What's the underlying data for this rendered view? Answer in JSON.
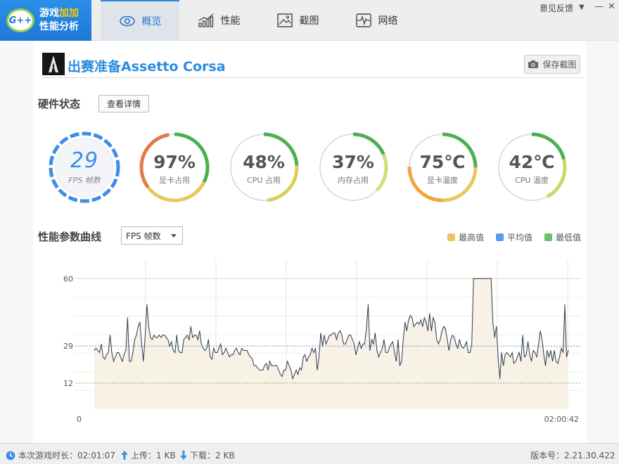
{
  "app": {
    "logo_mark": "G++",
    "logo_line1_a": "游戏",
    "logo_line1_b": "加加",
    "logo_line2": "性能分析"
  },
  "nav": {
    "tabs": [
      {
        "label": "概览",
        "icon": "eye-icon",
        "active": true
      },
      {
        "label": "性能",
        "icon": "bar-chart-icon",
        "active": false
      },
      {
        "label": "截图",
        "icon": "image-icon",
        "active": false
      },
      {
        "label": "网络",
        "icon": "pulse-icon",
        "active": false
      }
    ],
    "feedback": "意见反馈",
    "dropdown_glyph": "▼",
    "minimize_glyph": "—",
    "close_glyph": "✕"
  },
  "game": {
    "title": "出赛准备Assetto Corsa",
    "icon": "assassin-logo-icon",
    "save_label": "保存截图"
  },
  "hardware": {
    "title": "硬件状态",
    "detail_button": "查看详情",
    "fps": {
      "value": "29",
      "label": "FPS 帧数"
    },
    "gauges": [
      {
        "value": "97%",
        "label": "显卡占用",
        "fill": 0.97,
        "colors": [
          "#4caf50",
          "#e9c75a",
          "#e07a4a"
        ]
      },
      {
        "value": "48%",
        "label": "CPU 占用",
        "fill": 0.48,
        "colors": [
          "#4caf50",
          "#d8cf62"
        ]
      },
      {
        "value": "37%",
        "label": "内存占用",
        "fill": 0.37,
        "colors": [
          "#4caf50",
          "#cfe07a"
        ]
      },
      {
        "value": "75℃",
        "label": "显卡温度",
        "fill": 0.75,
        "colors": [
          "#4caf50",
          "#e9c75a",
          "#f0a63a"
        ]
      },
      {
        "value": "42℃",
        "label": "CPU 温度",
        "fill": 0.42,
        "colors": [
          "#4caf50",
          "#cfd66a"
        ]
      }
    ]
  },
  "curve": {
    "title": "性能参数曲线",
    "selector": "FPS 帧数",
    "legend": [
      {
        "label": "最高值",
        "color": "#e8c46a"
      },
      {
        "label": "平均值",
        "color": "#5b9be8"
      },
      {
        "label": "最低值",
        "color": "#6cbf6c"
      }
    ]
  },
  "chart_data": {
    "type": "line",
    "series": [
      {
        "name": "FPS 帧数",
        "values": [
          27,
          28,
          27,
          26,
          30,
          24,
          23,
          25,
          26,
          34,
          26,
          22,
          24,
          26,
          26,
          24,
          22,
          25,
          27,
          42,
          22,
          22,
          26,
          32,
          34,
          38,
          40,
          30,
          22,
          34,
          48,
          38,
          33,
          32,
          34,
          33,
          33,
          34,
          33,
          34,
          34,
          33,
          32,
          29,
          31,
          27,
          26,
          34,
          27,
          26,
          26,
          32,
          33,
          34,
          32,
          38,
          33,
          34,
          34,
          32,
          36,
          30,
          28,
          27,
          28,
          32,
          24,
          23,
          28,
          26,
          26,
          28,
          30,
          25,
          26,
          28,
          26,
          24,
          25,
          25,
          27,
          28,
          26,
          25,
          28,
          27,
          27,
          27,
          25,
          24,
          23,
          20,
          20,
          19,
          18,
          18,
          18,
          20,
          21,
          18,
          22,
          20,
          20,
          20,
          20,
          18,
          16,
          15,
          18,
          18,
          22,
          20,
          18,
          14,
          16,
          18,
          16,
          19,
          18,
          24,
          25,
          22,
          24,
          25,
          28,
          26,
          28,
          18,
          24,
          35,
          29,
          34,
          30,
          32,
          34,
          34,
          35,
          35,
          32,
          35,
          36,
          34,
          30,
          30,
          32,
          34,
          34,
          32,
          30,
          25,
          28,
          31,
          28,
          30,
          30,
          37,
          48,
          27,
          32,
          30,
          35,
          27,
          24,
          26,
          28,
          32,
          26,
          26,
          28,
          30,
          31,
          26,
          22,
          32,
          20,
          22,
          32,
          40,
          36,
          41,
          43,
          42,
          38,
          39,
          40,
          39,
          41,
          38,
          42,
          40,
          36,
          44,
          36,
          42,
          40,
          32,
          30,
          32,
          36,
          38,
          37,
          32,
          27,
          32,
          34,
          33,
          30,
          28,
          32,
          29,
          28,
          29,
          31,
          26,
          26,
          30,
          60,
          60,
          60,
          60,
          60,
          60,
          60,
          60,
          60,
          60,
          60,
          40,
          33,
          38,
          24,
          14,
          26,
          20,
          25,
          26,
          25,
          24,
          26,
          21,
          22,
          24,
          26,
          22,
          34,
          24,
          25,
          31,
          25,
          22,
          27,
          26,
          24,
          30,
          36,
          32,
          25,
          20,
          27,
          24,
          27,
          22,
          27,
          22,
          21,
          24,
          28,
          26,
          48,
          24,
          27
        ]
      }
    ],
    "x_start": "0",
    "x_end": "02:00:42",
    "y_ticks": [
      12,
      29,
      60
    ],
    "ylim": [
      0,
      60
    ],
    "max": 60,
    "avg": 29,
    "min": 12,
    "grid": true
  },
  "status": {
    "duration": "本次游戏时长：02:01:07",
    "upload": "上传：1 KB",
    "download": "下载：2 KB",
    "version": "版本号：2.21.30.422"
  }
}
